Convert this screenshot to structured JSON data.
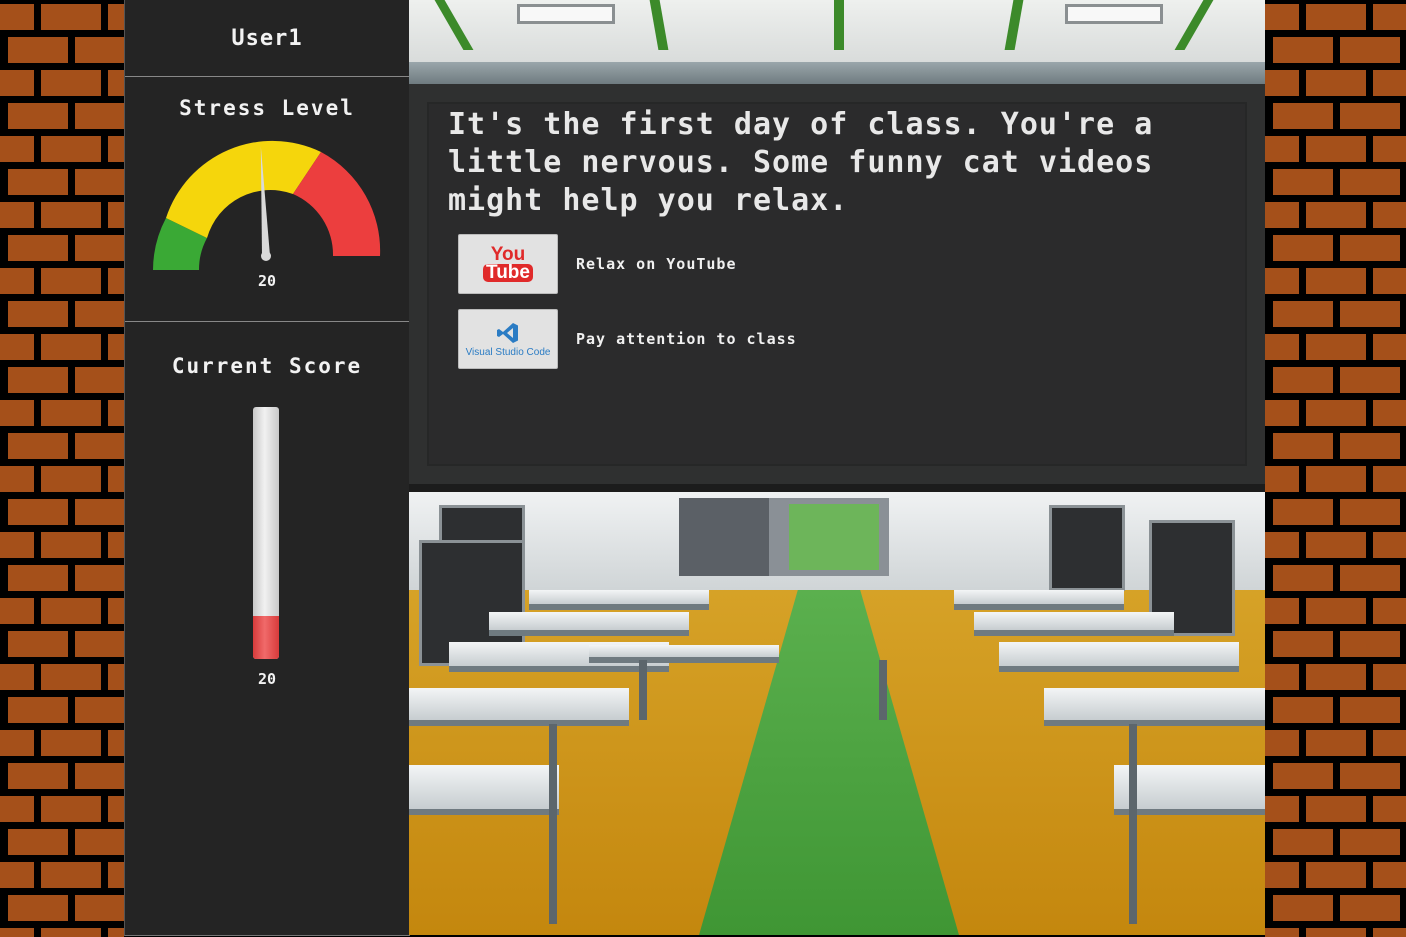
{
  "user": {
    "name": "User1"
  },
  "stress": {
    "title": "Stress Level",
    "value": "20",
    "value_fraction": 0.2
  },
  "score": {
    "title": "Current Score",
    "value": "20",
    "fill_fraction": 0.17
  },
  "scene": {
    "story": "It's the first day of class. You're a\nlittle nervous. Some funny cat videos\nmight help you relax.",
    "choices": [
      {
        "icon": "youtube-icon",
        "logo_top": "You",
        "logo_bottom": "Tube",
        "label": "Relax on YouTube"
      },
      {
        "icon": "vscode-icon",
        "logo_text": "Visual Studio Code",
        "label": "Pay attention to class"
      }
    ]
  },
  "colors": {
    "brick": "#a5501a",
    "sidebar": "#242424",
    "gauge_green": "#3aa935",
    "gauge_yellow": "#f5d60c",
    "gauge_red": "#ec3e3e",
    "thermo_fill": "#e04848"
  }
}
